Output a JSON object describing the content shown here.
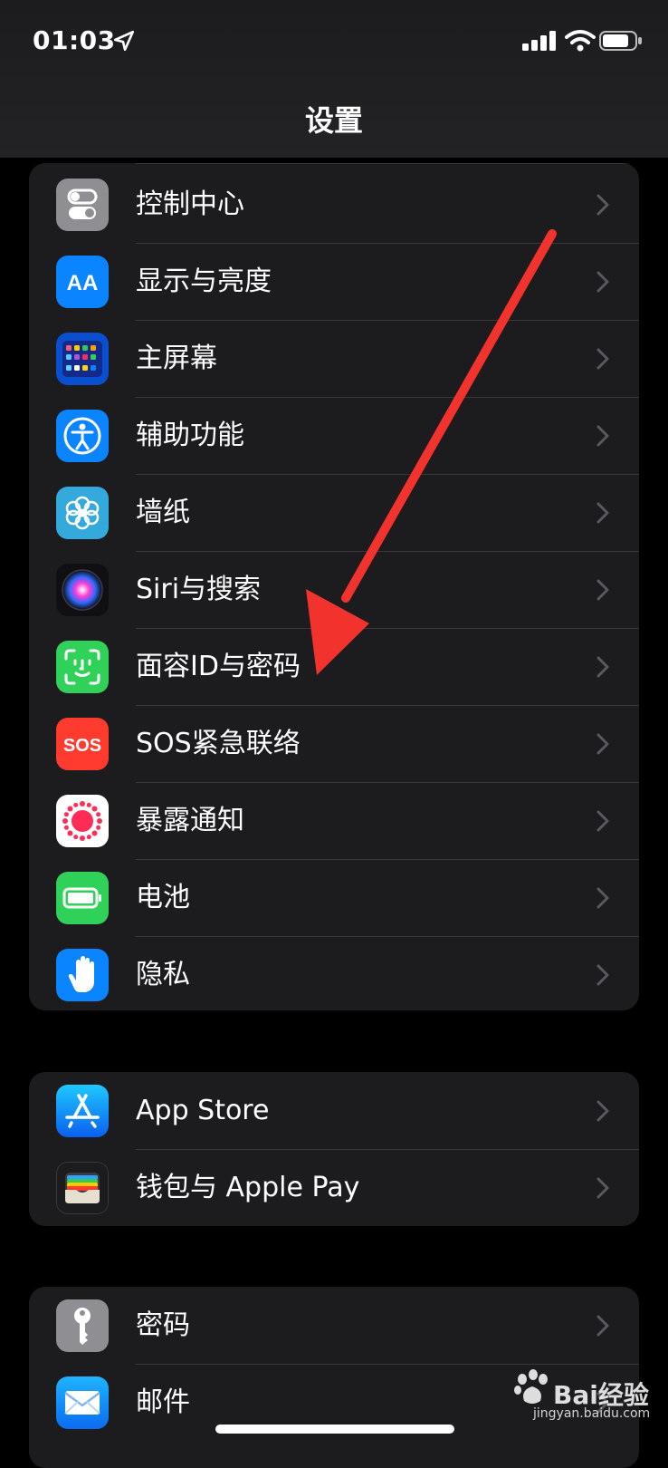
{
  "status_bar": {
    "time": "01:03"
  },
  "nav": {
    "title": "设置"
  },
  "groups": [
    {
      "items": [
        {
          "label": "控制中心",
          "icon": "control-center-icon",
          "color": "#8e8e93"
        },
        {
          "label": "显示与亮度",
          "icon": "display-brightness-icon",
          "color": "#0a84ff"
        },
        {
          "label": "主屏幕",
          "icon": "home-screen-icon",
          "color": "#0a60d8"
        },
        {
          "label": "辅助功能",
          "icon": "accessibility-icon",
          "color": "#0a84ff"
        },
        {
          "label": "墙纸",
          "icon": "wallpaper-icon",
          "color": "#34aadc"
        },
        {
          "label": "Siri与搜索",
          "icon": "siri-icon",
          "color": "#1c1c1e"
        },
        {
          "label": "面容ID与密码",
          "icon": "face-id-icon",
          "color": "#30d158"
        },
        {
          "label": "SOS紧急联络",
          "icon": "sos-icon",
          "color": "#ff3b30"
        },
        {
          "label": "暴露通知",
          "icon": "exposure-notification-icon",
          "color": "#ffffff"
        },
        {
          "label": "电池",
          "icon": "battery-icon",
          "color": "#30d158"
        },
        {
          "label": "隐私",
          "icon": "privacy-hand-icon",
          "color": "#0a84ff"
        }
      ]
    },
    {
      "items": [
        {
          "label": "App Store",
          "icon": "app-store-icon",
          "color": "#0a84ff"
        },
        {
          "label": "钱包与 Apple Pay",
          "icon": "wallet-icon",
          "color": "#1c1c1e"
        }
      ]
    },
    {
      "items": [
        {
          "label": "密码",
          "icon": "key-icon",
          "color": "#8e8e93"
        },
        {
          "label": "邮件",
          "icon": "mail-icon",
          "color": "#0a84ff"
        }
      ]
    }
  ],
  "watermark": {
    "text": "Bai经验",
    "url": "jingyan.baidu.com"
  }
}
